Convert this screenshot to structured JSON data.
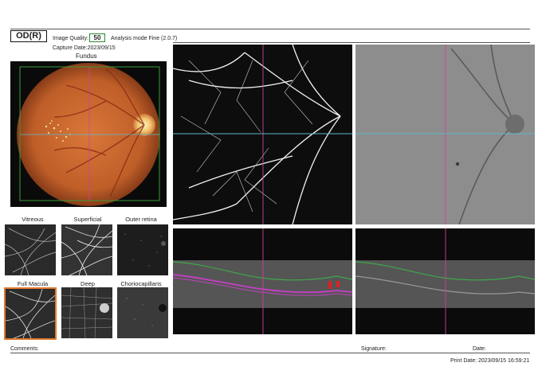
{
  "header": {
    "eye": "OD(R)",
    "image_quality_label": "Image Quality:",
    "image_quality_value": "50",
    "analysis_mode": "Analysis mode Fine (2.0.7)",
    "capture_date": "Capture Date:2023/09/15"
  },
  "fundus": {
    "title": "Fundus"
  },
  "thumbnails": [
    {
      "label": "Vitreous"
    },
    {
      "label": "Superficial"
    },
    {
      "label": "Outer retina"
    },
    {
      "label": "Full Macula"
    },
    {
      "label": "Deep"
    },
    {
      "label": "Choriocapillaris"
    }
  ],
  "footer": {
    "comments": "Comments:",
    "signature": "Signature:",
    "date": "Date:",
    "print_date": "Print Date: 2023/09/15 16:59:21"
  },
  "colors": {
    "crosshair_magenta": "#d0409a",
    "crosshair_cyan": "#5fb8c8",
    "frame_green": "#3a9a3a",
    "selected_orange": "#e07a30"
  }
}
